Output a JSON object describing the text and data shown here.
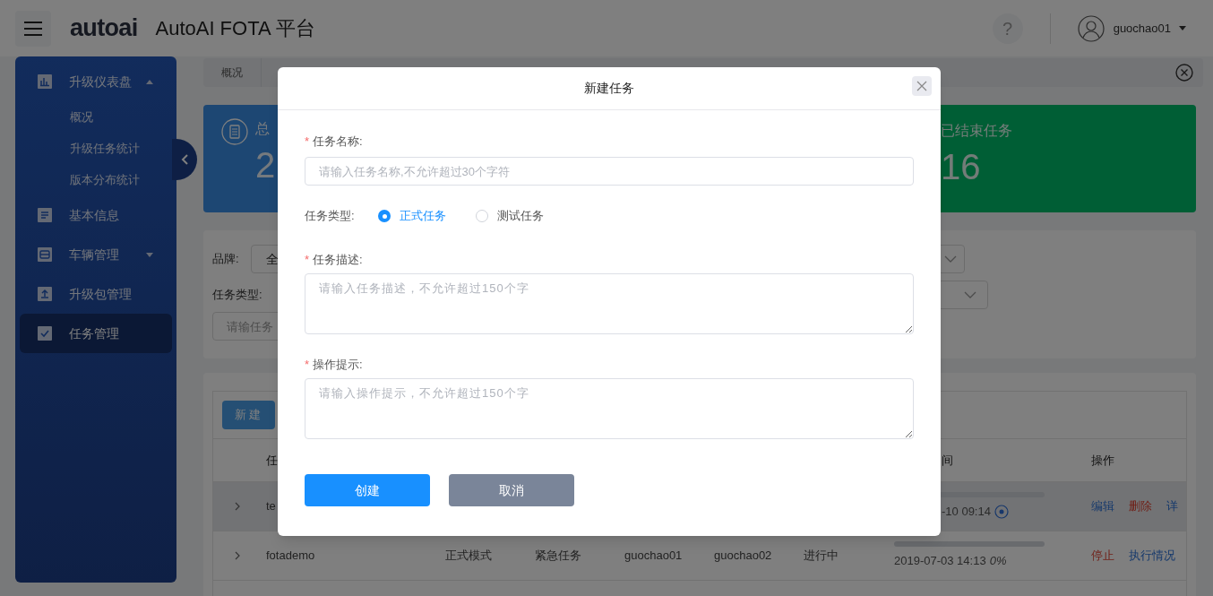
{
  "header": {
    "logo": "autoai",
    "title": "AutoAI FOTA 平台",
    "help": "?",
    "user": "guochao01"
  },
  "sidebar": {
    "items": [
      {
        "label": "升级仪表盘",
        "selected": false,
        "expanded": true,
        "children": [
          {
            "label": "概况"
          },
          {
            "label": "升级任务统计"
          },
          {
            "label": "版本分布统计"
          }
        ]
      },
      {
        "label": "基本信息",
        "selected": false
      },
      {
        "label": "车辆管理",
        "selected": false,
        "expanded": false
      },
      {
        "label": "升级包管理",
        "selected": false
      },
      {
        "label": "任务管理",
        "selected": true
      }
    ]
  },
  "breadcrumb_tab": "概况",
  "stat_cards": [
    {
      "title": "总",
      "value": "2",
      "kind": "total"
    },
    {
      "title": "已结束任务",
      "value": "16",
      "kind": "finished"
    }
  ],
  "filters": {
    "brand_label": "品牌:",
    "brand_value": "全",
    "task_type_label": "任务类型:",
    "search_placeholder": "请输任务"
  },
  "table": {
    "new_button": "新建",
    "headers": {
      "name": "任",
      "time": "间",
      "actions": "操作"
    },
    "rows": [
      {
        "name": "te",
        "time": "-10 09:14",
        "level": 0,
        "hover": true,
        "actions": [
          {
            "label": "编辑",
            "kind": "link"
          },
          {
            "label": "删除",
            "kind": "danger"
          },
          {
            "label": "详",
            "kind": "link"
          }
        ]
      },
      {
        "name": "fotademo",
        "mode": "正式模式",
        "priority": "紧急任务",
        "creator": "guochao01",
        "approver": "guochao02",
        "status": "进行中",
        "time": "2019-07-03 14:13",
        "percent": "0%",
        "level": 0,
        "hover": false,
        "actions": [
          {
            "label": "停止",
            "kind": "danger"
          },
          {
            "label": "执行情况",
            "kind": "link"
          }
        ]
      }
    ]
  },
  "dialog": {
    "title": "新建任务",
    "required_mark": "*",
    "fields": [
      {
        "kind": "input",
        "label": "任务名称:",
        "required": true,
        "placeholder": "请输入任务名称,不允许超过30个字符"
      },
      {
        "kind": "radio",
        "label": "任务类型:",
        "required": false,
        "options": [
          {
            "label": "正式任务",
            "selected": true
          },
          {
            "label": "测试任务",
            "selected": false
          }
        ]
      },
      {
        "kind": "textarea",
        "label": "任务描述:",
        "required": true,
        "placeholder": "请输入任务描述，不允许超过150个字"
      },
      {
        "kind": "textarea",
        "label": "操作提示:",
        "required": true,
        "placeholder": "请输入操作提示，不允许超过150个字"
      }
    ],
    "buttons": [
      {
        "label": "创建",
        "kind": "primary"
      },
      {
        "label": "取消",
        "kind": "secondary"
      }
    ]
  }
}
